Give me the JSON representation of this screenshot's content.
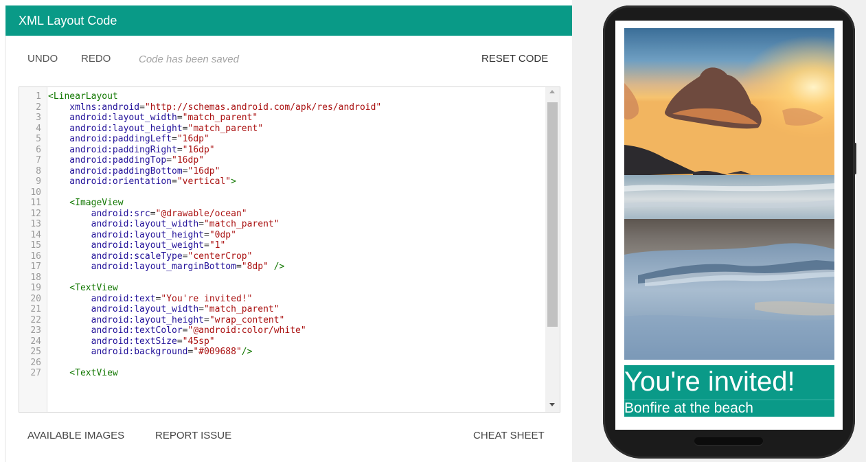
{
  "header": {
    "title": "XML Layout Code"
  },
  "toolbar": {
    "undo": "UNDO",
    "redo": "REDO",
    "status": "Code has been saved",
    "reset": "RESET CODE"
  },
  "footer": {
    "images": "AVAILABLE IMAGES",
    "report": "REPORT ISSUE",
    "cheat": "CHEAT SHEET"
  },
  "code_lines": [
    [
      [
        "tag",
        "<LinearLayout"
      ]
    ],
    [
      [
        "attr",
        "    xmlns:android"
      ],
      [
        "pun",
        "="
      ],
      [
        "str",
        "\"http://schemas.android.com/apk/res/android\""
      ]
    ],
    [
      [
        "attr",
        "    android:layout_width"
      ],
      [
        "pun",
        "="
      ],
      [
        "str",
        "\"match_parent\""
      ]
    ],
    [
      [
        "attr",
        "    android:layout_height"
      ],
      [
        "pun",
        "="
      ],
      [
        "str",
        "\"match_parent\""
      ]
    ],
    [
      [
        "attr",
        "    android:paddingLeft"
      ],
      [
        "pun",
        "="
      ],
      [
        "str",
        "\"16dp\""
      ]
    ],
    [
      [
        "attr",
        "    android:paddingRight"
      ],
      [
        "pun",
        "="
      ],
      [
        "str",
        "\"16dp\""
      ]
    ],
    [
      [
        "attr",
        "    android:paddingTop"
      ],
      [
        "pun",
        "="
      ],
      [
        "str",
        "\"16dp\""
      ]
    ],
    [
      [
        "attr",
        "    android:paddingBottom"
      ],
      [
        "pun",
        "="
      ],
      [
        "str",
        "\"16dp\""
      ]
    ],
    [
      [
        "attr",
        "    android:orientation"
      ],
      [
        "pun",
        "="
      ],
      [
        "str",
        "\"vertical\""
      ],
      [
        "tag",
        ">"
      ]
    ],
    [],
    [
      [
        "tag",
        "    <ImageView"
      ]
    ],
    [
      [
        "attr",
        "        android:src"
      ],
      [
        "pun",
        "="
      ],
      [
        "str",
        "\"@drawable/ocean\""
      ]
    ],
    [
      [
        "attr",
        "        android:layout_width"
      ],
      [
        "pun",
        "="
      ],
      [
        "str",
        "\"match_parent\""
      ]
    ],
    [
      [
        "attr",
        "        android:layout_height"
      ],
      [
        "pun",
        "="
      ],
      [
        "str",
        "\"0dp\""
      ]
    ],
    [
      [
        "attr",
        "        android:layout_weight"
      ],
      [
        "pun",
        "="
      ],
      [
        "str",
        "\"1\""
      ]
    ],
    [
      [
        "attr",
        "        android:scaleType"
      ],
      [
        "pun",
        "="
      ],
      [
        "str",
        "\"centerCrop\""
      ]
    ],
    [
      [
        "attr",
        "        android:layout_marginBottom"
      ],
      [
        "pun",
        "="
      ],
      [
        "str",
        "\"8dp\""
      ],
      [
        "tag",
        " />"
      ]
    ],
    [],
    [
      [
        "tag",
        "    <TextView"
      ]
    ],
    [
      [
        "attr",
        "        android:text"
      ],
      [
        "pun",
        "="
      ],
      [
        "str",
        "\"You're invited!\""
      ]
    ],
    [
      [
        "attr",
        "        android:layout_width"
      ],
      [
        "pun",
        "="
      ],
      [
        "str",
        "\"match_parent\""
      ]
    ],
    [
      [
        "attr",
        "        android:layout_height"
      ],
      [
        "pun",
        "="
      ],
      [
        "str",
        "\"wrap_content\""
      ]
    ],
    [
      [
        "attr",
        "        android:textColor"
      ],
      [
        "pun",
        "="
      ],
      [
        "str",
        "\"@android:color/white\""
      ]
    ],
    [
      [
        "attr",
        "        android:textSize"
      ],
      [
        "pun",
        "="
      ],
      [
        "str",
        "\"45sp\""
      ]
    ],
    [
      [
        "attr",
        "        android:background"
      ],
      [
        "pun",
        "="
      ],
      [
        "str",
        "\"#009688\""
      ],
      [
        "tag",
        "/>"
      ]
    ],
    [],
    [
      [
        "tag",
        "    <TextView"
      ]
    ]
  ],
  "preview": {
    "title": "You're invited!",
    "subtitle": "Bonfire at the beach",
    "accent": "#009688"
  },
  "colors": {
    "header": "#099a87",
    "tag": "#117700",
    "attr": "#221199",
    "string": "#aa1111"
  }
}
